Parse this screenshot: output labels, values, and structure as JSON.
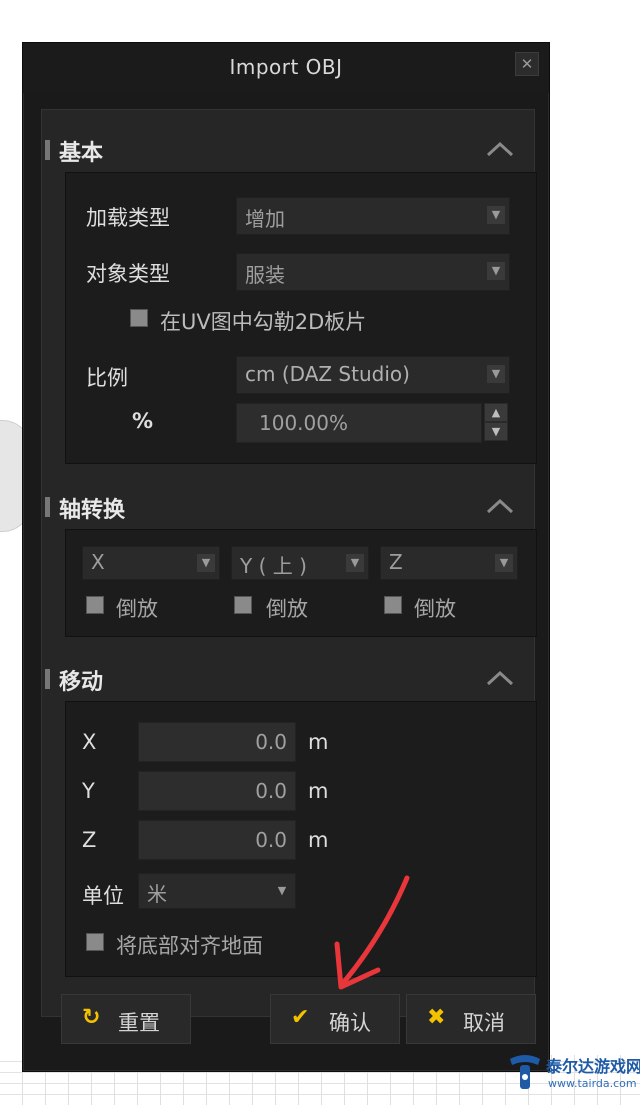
{
  "dialog": {
    "title": "Import OBJ",
    "close_label": "✕"
  },
  "basic": {
    "section_title": "基本",
    "load_type_label": "加载类型",
    "load_type_value": "增加",
    "object_type_label": "对象类型",
    "object_type_value": "服装",
    "uv_outline_label": "在UV图中勾勒2D板片",
    "uv_outline_checked": false,
    "scale_label": "比例",
    "scale_value": "cm (DAZ Studio)",
    "percent_label": "%",
    "percent_value": "100.00%"
  },
  "axis": {
    "section_title": "轴转换",
    "x_value": "X",
    "y_value": "Y ( 上 )",
    "z_value": "Z",
    "invert_label": "倒放",
    "invert_x_checked": false,
    "invert_y_checked": false,
    "invert_z_checked": false
  },
  "move": {
    "section_title": "移动",
    "x_label": "X",
    "x_value": "0.0",
    "y_label": "Y",
    "y_value": "0.0",
    "z_label": "Z",
    "z_value": "0.0",
    "unit_suffix": "m",
    "unit_label": "单位",
    "unit_value": "米",
    "align_ground_label": "将底部对齐地面",
    "align_ground_checked": false
  },
  "footer": {
    "reset_label": "重置",
    "confirm_label": "确认",
    "cancel_label": "取消"
  },
  "icons": {
    "reset": "refresh-icon",
    "confirm": "check-icon",
    "cancel": "x-icon",
    "collapse": "chevron-up-icon",
    "dropdown": "caret-down-icon"
  },
  "colors": {
    "accent": "#f2c200",
    "dialog_bg": "#1a1a1a",
    "annotation_arrow": "#e8363b"
  },
  "watermark": {
    "brand": "泰尔达游戏网",
    "url": "www.tairda.com"
  }
}
